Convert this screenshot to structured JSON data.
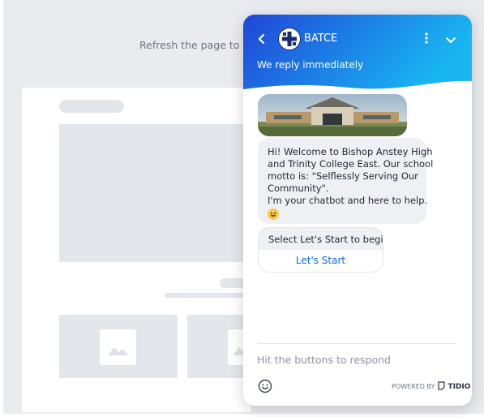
{
  "background": {
    "refresh_text": "Refresh the page to rest"
  },
  "chat": {
    "header": {
      "title": "BATCE",
      "subtitle": "We reply immediately",
      "back_icon": "chevron-left-icon",
      "menu_icon": "kebab-menu-icon",
      "collapse_icon": "chevron-down-icon",
      "gradient_start": "#1f46d8",
      "gradient_end": "#19b6f2"
    },
    "messages": [
      {
        "lines": [
          "Hi! Welcome to Bishop Anstey High",
          "and Trinity College East. Our school",
          "motto is: \"Selflessly Serving Our",
          "Community\".",
          "I'm your chatbot and here to help."
        ],
        "emoji": "grinning-face-emoji"
      },
      {
        "text": "Select Let's Start to begin.",
        "button": "Let's Start"
      }
    ],
    "input_placeholder": "Hit the buttons to respond",
    "powered_by": "POWERED BY",
    "brand": "TIDIO",
    "accent": "#0a66f0"
  }
}
